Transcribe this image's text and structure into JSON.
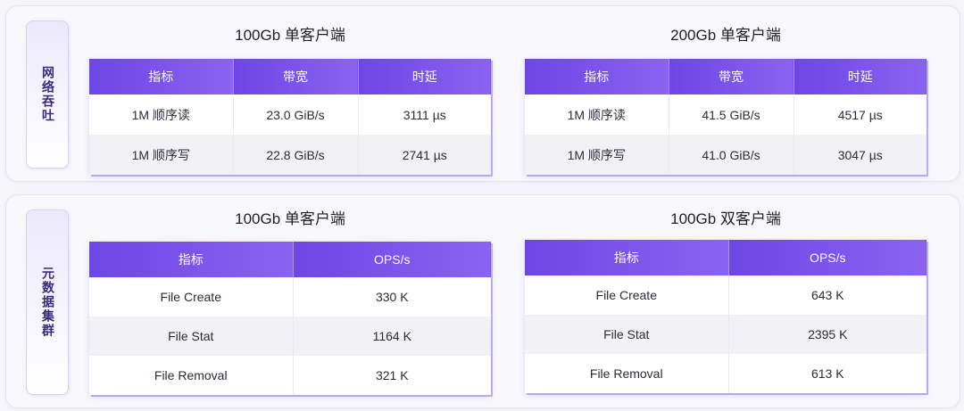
{
  "network": {
    "side_label": "网络吞吐",
    "tables": [
      {
        "title": "100Gb 单客户端",
        "headers": [
          "指标",
          "带宽",
          "时延"
        ],
        "rows": [
          [
            "1M 顺序读",
            "23.0 GiB/s",
            "3111 µs"
          ],
          [
            "1M 顺序写",
            "22.8 GiB/s",
            "2741 µs"
          ]
        ]
      },
      {
        "title": "200Gb 单客户端",
        "headers": [
          "指标",
          "带宽",
          "时延"
        ],
        "rows": [
          [
            "1M 顺序读",
            "41.5 GiB/s",
            "4517 µs"
          ],
          [
            "1M 顺序写",
            "41.0 GiB/s",
            "3047 µs"
          ]
        ]
      }
    ]
  },
  "metadata": {
    "side_label": "元数据集群",
    "tables": [
      {
        "title": "100Gb 单客户端",
        "headers": [
          "指标",
          "OPS/s"
        ],
        "rows": [
          [
            "File Create",
            "330 K"
          ],
          [
            "File Stat",
            "1164 K"
          ],
          [
            "File Removal",
            "321 K"
          ]
        ]
      },
      {
        "title": "100Gb 双客户端",
        "headers": [
          "指标",
          "OPS/s"
        ],
        "rows": [
          [
            "File Create",
            "643 K"
          ],
          [
            "File Stat",
            "2395 K"
          ],
          [
            "File Removal",
            "613 K"
          ]
        ]
      }
    ]
  },
  "colors": {
    "header_start": "#6d46e6",
    "header_end": "#8a63f0",
    "label_text": "#3a2c7a"
  }
}
